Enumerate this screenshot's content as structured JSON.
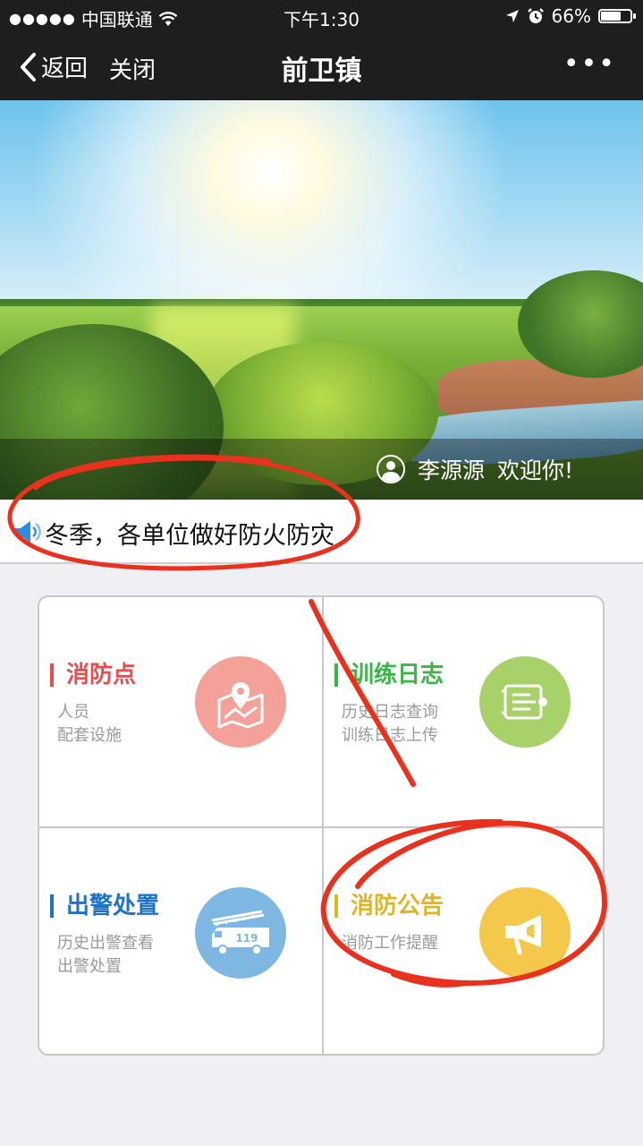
{
  "status_bar": {
    "signal": "●●●●●",
    "carrier": "中国联通",
    "time": "下午1:30",
    "battery_percent": "66%",
    "battery_level": 0.66
  },
  "nav": {
    "back_label": "返回",
    "close_label": "关闭",
    "title": "前卫镇",
    "more_label": "•••"
  },
  "banner": {
    "user_name": "李源源",
    "welcome_text": "欢迎你!"
  },
  "notice": {
    "text": "冬季，各单位做好防火防灾"
  },
  "menu": [
    {
      "title": "消防点",
      "lines": [
        "人员",
        "配套设施"
      ],
      "color": "#e84c4c",
      "icon": "map-pin-icon",
      "icon_bg": "#f4a19a"
    },
    {
      "title": "训练日志",
      "lines": [
        "历史日志查询",
        "训练日志上传"
      ],
      "color": "#3bb44a",
      "icon": "log-list-icon",
      "icon_bg": "#a9d16a"
    },
    {
      "title": "出警处置",
      "lines": [
        "历史出警查看",
        "出警处置"
      ],
      "color": "#1e73c8",
      "icon": "fire-truck-icon",
      "icon_bg": "#7eb8e2",
      "icon_text": "119"
    },
    {
      "title": "消防公告",
      "lines": [
        "消防工作提醒"
      ],
      "color": "#e0b520",
      "icon": "megaphone-icon",
      "icon_bg": "#f3c84b"
    }
  ],
  "colors": {
    "bar_bg": "#1e1e1e",
    "annotation_red": "#e8321e",
    "notice_icon": "#2a8de0"
  }
}
